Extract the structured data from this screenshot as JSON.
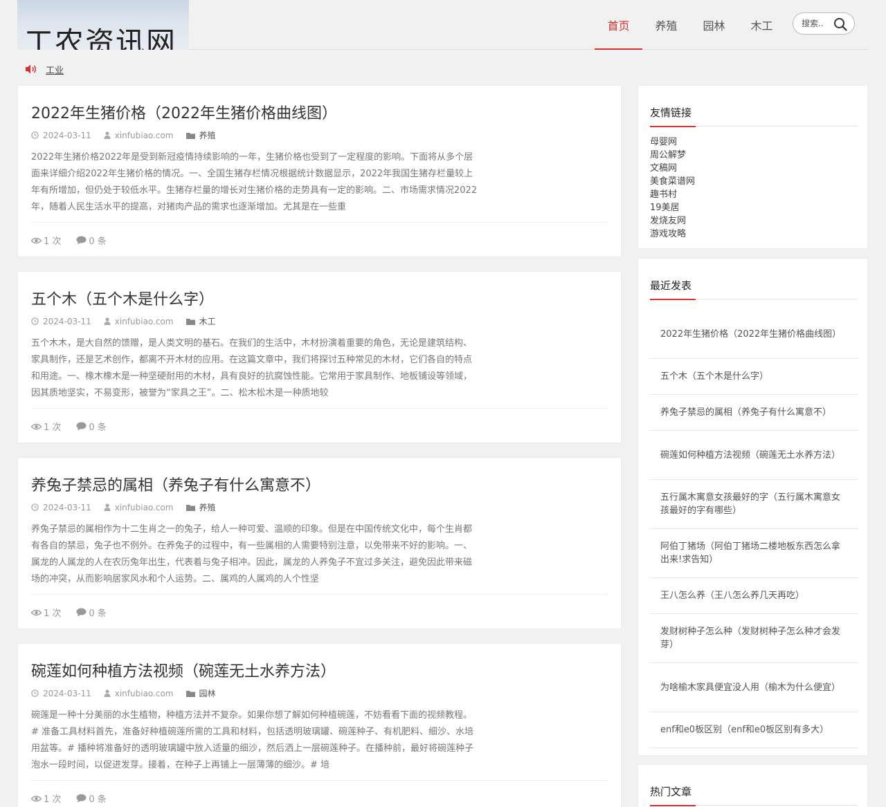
{
  "header": {
    "logo_text": "工农资讯网",
    "nav": [
      "首页",
      "养殖",
      "园林",
      "木工"
    ],
    "search_placeholder": "搜索.."
  },
  "notice": {
    "link": "工业"
  },
  "posts": [
    {
      "title": "2022年生猪价格（2022年生猪价格曲线图）",
      "date": "2024-03-11",
      "author": "xinfubiao.com",
      "category": "养殖",
      "excerpt": "2022年生猪价格2022年是受到新冠疫情持续影响的一年，生猪价格也受到了一定程度的影响。下面将从多个层面来详细介绍2022年生猪价格的情况。一、全国生猪存栏情况根据统计数据显示，2022年我国生猪存栏量较上年有所增加，但仍处于较低水平。生猪存栏量的增长对生猪价格的走势具有一定的影响。二、市场需求情况2022年，随着人民生活水平的提高，对猪肉产品的需求也逐渐增加。尤其是在一些重",
      "views": "1 次",
      "comments": "0 条"
    },
    {
      "title": "五个木（五个木是什么字）",
      "date": "2024-03-11",
      "author": "xinfubiao.com",
      "category": "木工",
      "excerpt": "五个木木，是大自然的馈赠，是人类文明的基石。在我们的生活中，木材扮演着重要的角色，无论是建筑结构、家具制作，还是艺术创作，都离不开木材的应用。在这篇文章中，我们将探讨五种常见的木材，它们各自的特点和用途。一、橡木橡木是一种坚硬耐用的木材，具有良好的抗腐蚀性能。它常用于家具制作、地板铺设等领域，因其质地坚实，不易变形，被誉为“家具之王”。二、松木松木是一种质地较",
      "views": "1 次",
      "comments": "0 条"
    },
    {
      "title": "养兔子禁忌的属相（养兔子有什么寓意不）",
      "date": "2024-03-11",
      "author": "xinfubiao.com",
      "category": "养殖",
      "excerpt": "养兔子禁忌的属相作为十二生肖之一的兔子，给人一种可爱、温顺的印象。但是在中国传统文化中，每个生肖都有各自的禁忌，兔子也不例外。在养兔子的过程中，有一些属相的人需要特别注意，以免带来不好的影响。一、属龙的人属龙的人在农历兔年出生，代表着与兔子相冲。因此，属龙的人养兔子不宜过多关注，避免因此带来磁场的冲突，从而影响居家风水和个人运势。二、属鸡的人属鸡的人个性坚",
      "views": "1 次",
      "comments": "0 条"
    },
    {
      "title": "碗莲如何种植方法视频（碗莲无土水养方法）",
      "date": "2024-03-11",
      "author": "xinfubiao.com",
      "category": "园林",
      "excerpt": "碗莲是一种十分美丽的水生植物，种植方法并不复杂。如果你想了解如何种植碗莲，不妨看看下面的视频教程。# 准备工具材料首先，准备好种植碗莲所需的工具和材料，包括透明玻璃罐、碗莲种子、有机肥料、细沙、水培用盆等。# 播种将准备好的透明玻璃罐中放入适量的细沙，然后洒上一层碗莲种子。在播种前，最好将碗莲种子泡水一段时间，以促进发芽。接着，在种子上再铺上一层薄薄的细沙。# 培",
      "views": "1 次",
      "comments": "0 条"
    }
  ],
  "sidebar": {
    "links_title": "友情链接",
    "links": [
      "母婴网",
      "周公解梦",
      "文稿网",
      "美食菜谱网",
      "趣书村",
      "19美居",
      "发烧友网",
      "游戏攻略"
    ],
    "recent_title": "最近发表",
    "recent": [
      "2022年生猪价格（2022年生猪价格曲线图）",
      "五个木（五个木是什么字）",
      "养兔子禁忌的属相（养兔子有什么寓意不）",
      "碗莲如何种植方法视频（碗莲无土水养方法）",
      "五行属木寓意女孩最好的字（五行属木寓意女孩最好的字有哪些）",
      "阿伯丁猪场（阿伯丁猪场二楼地板东西怎么拿出来!求告知）",
      "王八怎么养（王八怎么养几天再吃）",
      "发财树种子怎么种（发财树种子怎么种才会发芽）",
      "为啥榆木家具便宜没人用（榆木为什么便宜）",
      "enf和e0板区别（enf和e0板区别有多大）"
    ],
    "hot_title": "热门文章"
  },
  "colors": {
    "accent": "#d9302d",
    "background": "#f1f1f1",
    "card": "#ffffff"
  }
}
